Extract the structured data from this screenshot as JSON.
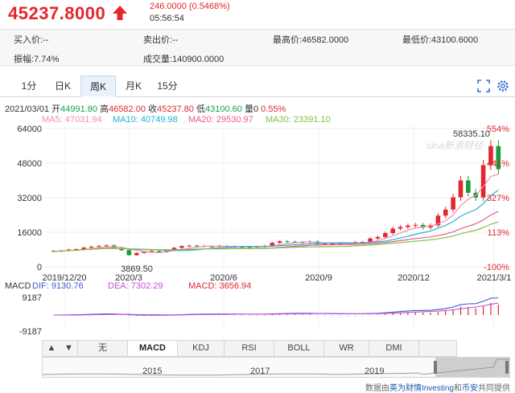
{
  "header": {
    "price": "45237.8000",
    "change": "246.0000 (0.5468%)",
    "time": "05:56:54",
    "up_color": "#e4262d"
  },
  "quote": {
    "bid": "买入价:--",
    "ask": "卖出价:--",
    "high": "最高价:46582.0000",
    "low": "最低价:43100.6000",
    "amplitude": "振幅:7.74%",
    "volume": "成交量:140900.0000"
  },
  "tabs": [
    {
      "label": "1分",
      "active": false
    },
    {
      "label": "日K",
      "active": false
    },
    {
      "label": "周K",
      "active": true
    },
    {
      "label": "月K",
      "active": false
    },
    {
      "label": "15分",
      "active": false
    }
  ],
  "toolbar": {
    "icons": [
      "fullscreen-icon",
      "settings-icon"
    ]
  },
  "ohlc": {
    "date": "2021/03/01",
    "open_label": "开",
    "open": "44991.80",
    "high_label": "高",
    "high": "46582.00",
    "close_label": "收",
    "close": "45237.80",
    "low_label": "低",
    "low": "43100.60",
    "vol_label": "量",
    "vol": "0",
    "pct": "0.55%"
  },
  "ma": [
    {
      "label": "MA5: 47031.94",
      "color": "#f28bb6"
    },
    {
      "label": "MA10: 40749.98",
      "color": "#25b0d6"
    },
    {
      "label": "MA20: 29530.97",
      "color": "#ea5a8c"
    },
    {
      "label": "MA30: 23391.10",
      "color": "#82c341"
    }
  ],
  "chart_data": {
    "type": "candlestick",
    "y_ticks": [
      "64000",
      "48000",
      "32000",
      "16000",
      "0"
    ],
    "right_pct_labels": [
      "554%",
      "441%",
      "327%",
      "113%",
      "-100%"
    ],
    "x_labels": [
      "2019/12/20",
      "2020/3",
      "2020/6",
      "2020/9",
      "2020/12",
      "2021/3/1"
    ],
    "annotations": {
      "max": "58335.10",
      "min": "3869.50"
    },
    "watermark": "sina新浪财经",
    "candles_weekly_close": [
      7150,
      7500,
      8000,
      8200,
      8900,
      9300,
      9600,
      9900,
      8700,
      7700,
      5400,
      6400,
      6900,
      7300,
      6800,
      7700,
      8800,
      9600,
      9800,
      9700,
      9500,
      9300,
      9700,
      9400,
      9250,
      9200,
      9150,
      9300,
      9700,
      11100,
      11800,
      11600,
      11400,
      11300,
      11700,
      10500,
      10700,
      10800,
      10600,
      10700,
      11400,
      11500,
      13100,
      13800,
      15600,
      17700,
      18400,
      19100,
      19400,
      18200,
      19200,
      23700,
      26500,
      32200,
      40000,
      34300,
      32100,
      47100,
      55900,
      45200
    ],
    "candles_weekly_open": [
      7400,
      7150,
      7500,
      8000,
      8200,
      8900,
      9300,
      9600,
      9900,
      8700,
      7700,
      5400,
      6400,
      6900,
      7300,
      6800,
      7700,
      8800,
      9600,
      9800,
      9700,
      9500,
      9300,
      9700,
      9400,
      9250,
      9200,
      9150,
      9300,
      9700,
      11100,
      11800,
      11600,
      11400,
      11300,
      11700,
      10500,
      10700,
      10800,
      10600,
      10700,
      11400,
      11500,
      13100,
      13800,
      15600,
      17700,
      18400,
      19100,
      19400,
      18200,
      19200,
      23700,
      26500,
      32200,
      40000,
      34300,
      32100,
      47100,
      55900
    ],
    "macd": {
      "label": "MACD",
      "dif_label": "DIF: 9130.76",
      "dea_label": "DEA: 7302.29",
      "macd_label": "MACD: 3656.94",
      "y_ticks": [
        "9187",
        "-9187"
      ],
      "dif_color": "#3b5fd0",
      "dea_color": "#c14fd8"
    }
  },
  "indicators": [
    {
      "label": "▲",
      "active": false
    },
    {
      "label": "▼",
      "active": false
    },
    {
      "label": "无",
      "active": false
    },
    {
      "label": "MACD",
      "active": true
    },
    {
      "label": "KDJ",
      "active": false
    },
    {
      "label": "RSI",
      "active": false
    },
    {
      "label": "BOLL",
      "active": false
    },
    {
      "label": "WR",
      "active": false
    },
    {
      "label": "DMI",
      "active": false
    }
  ],
  "navigator": {
    "years": [
      "2015",
      "2017",
      "2019"
    ]
  },
  "footer": {
    "prefix": "数据由",
    "brand": "英为财情Investing",
    "mid": "和",
    "brand2": "币安",
    "suffix": "共同提供"
  }
}
